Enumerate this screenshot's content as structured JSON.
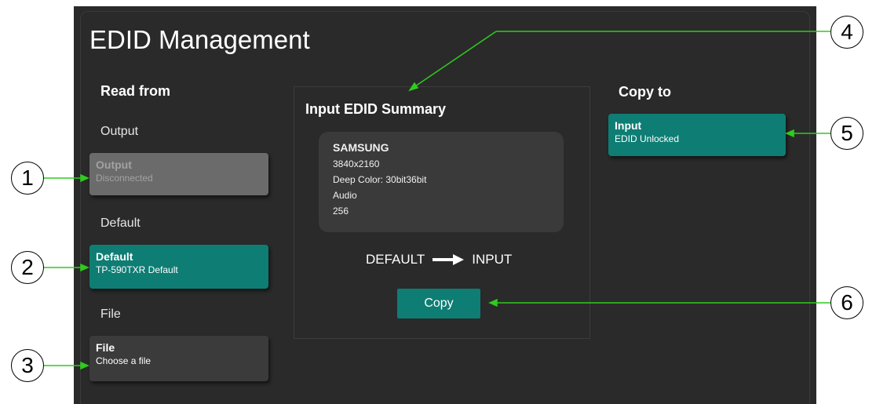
{
  "page": {
    "title": "EDID Management"
  },
  "read_from": {
    "heading": "Read from",
    "output": {
      "label": "Output",
      "card_title": "Output",
      "card_status": "Disconnected"
    },
    "default": {
      "label": "Default",
      "card_title": "Default",
      "card_status": "TP-590TXR Default"
    },
    "file": {
      "label": "File",
      "card_title": "File",
      "card_status": "Choose a file"
    }
  },
  "summary": {
    "heading": "Input EDID Summary",
    "brand": "SAMSUNG",
    "lines": [
      "3840x2160",
      "Deep Color: 30bit36bit",
      "Audio",
      "256"
    ],
    "flow_from": "DEFAULT",
    "flow_to": "INPUT",
    "copy_label": "Copy"
  },
  "copy_to": {
    "heading": "Copy to",
    "input": {
      "card_title": "Input",
      "card_status": "EDID Unlocked"
    }
  },
  "callouts": [
    "1",
    "2",
    "3",
    "4",
    "5",
    "6"
  ],
  "colors": {
    "accent": "#0e7d74",
    "panel": "#2a2a2a",
    "disabled": "#6b6b6b",
    "arrow": "#2ecc1c"
  }
}
